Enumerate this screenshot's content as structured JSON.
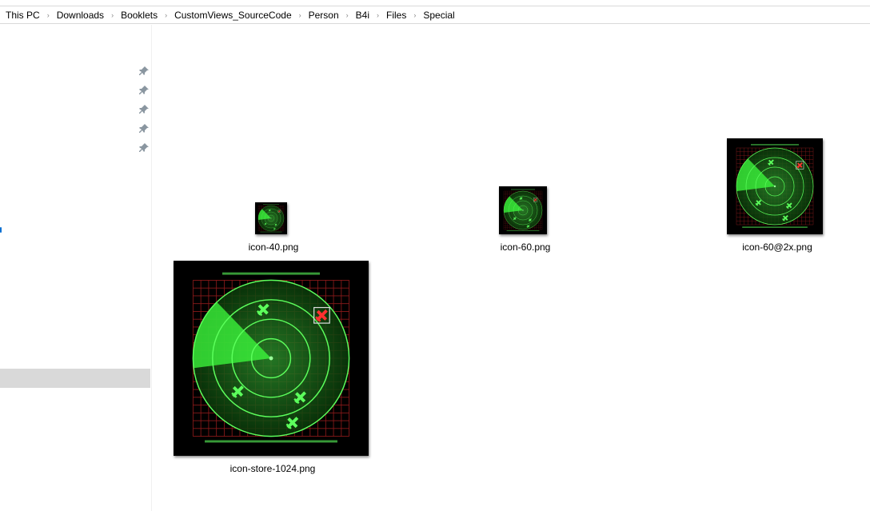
{
  "breadcrumb": [
    "This PC",
    "Downloads",
    "Booklets",
    "CustomViews_SourceCode",
    "Person",
    "B4i",
    "Files",
    "Special"
  ],
  "breadcrumb_separator": "›",
  "sidebar": {
    "pinned_count": 5
  },
  "files": [
    {
      "name": "icon-40.png",
      "icon": "radar-thumbnail"
    },
    {
      "name": "icon-60.png",
      "icon": "radar-thumbnail"
    },
    {
      "name": "icon-60@2x.png",
      "icon": "radar-thumbnail"
    },
    {
      "name": "icon-store-1024.png",
      "icon": "radar-thumbnail"
    }
  ]
}
